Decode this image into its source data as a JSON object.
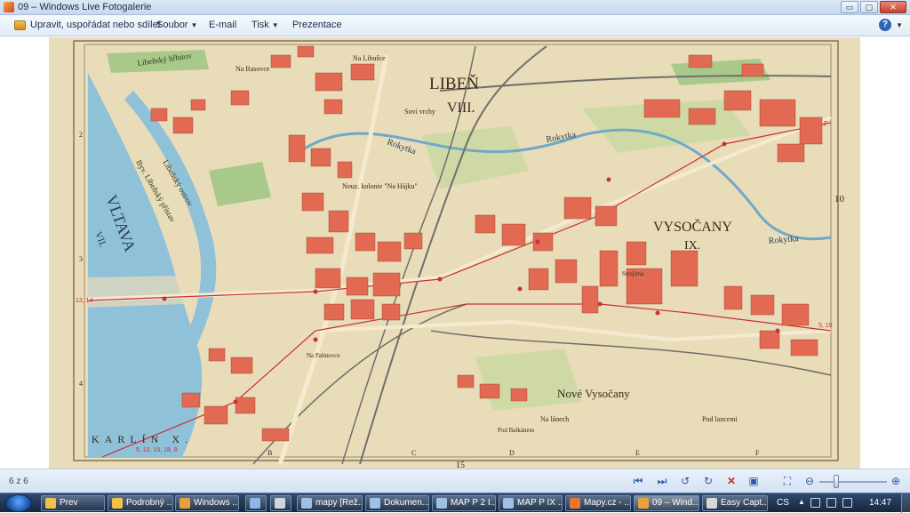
{
  "window": {
    "title": "09 – Windows Live Fotogalerie",
    "controls": {
      "minimize": "▭",
      "maximize": "▢",
      "close": "✕"
    }
  },
  "toolbar": {
    "organize": "Upravit, uspořádat nebo sdílet",
    "file": "Soubor",
    "email": "E-mail",
    "print": "Tisk",
    "slideshow": "Prezentace",
    "help": "?"
  },
  "map": {
    "district_liben": "LIBEŇ",
    "district_liben_num": "VIII.",
    "district_vysocany": "VYSOČANY",
    "district_vysocany_num": "IX.",
    "district_karlin": "KARLÍN X.",
    "river_vltava": "VLTAVA",
    "river_vltava_num": "VII.",
    "stream": "Rokytka",
    "stream_2": "Rokytka",
    "stream_3": "Rokytka",
    "cemetery": "Libeňský hřbitov",
    "port": "Byv. Libeňský přístav",
    "island": "Libeňský ostrov",
    "colony": "Nouz. kolonie \"Na Hájku\"",
    "nove_vysocany": "Nové Vysočany",
    "sovi_vrchy": "Soví vrchy",
    "na_rasovce": "Na Rasovce",
    "na_libusce": "Na Libušce",
    "pod_lancemi": "Pod lancemi",
    "na_lanech": "Na lánech",
    "pod_balkanem": "Pod Balkánem",
    "palmovka": "Na Palmovce",
    "stredoz": "Strojírna",
    "gridnum_10": "10",
    "sheet_num": "15",
    "col_b": "B",
    "col_c": "C",
    "col_d": "D",
    "col_e": "E",
    "col_f": "F",
    "row_2": "2",
    "row_3": "3",
    "row_4": "4",
    "edge_left": "13, 14",
    "edge_right": "5, 10",
    "edge_bottom": "5, 10, 15, 18, 8",
    "edge_f": "F"
  },
  "status": {
    "counter": "6 z 6"
  },
  "taskbar": {
    "items": [
      "Prev",
      "Podrobný ...",
      "Windows ...",
      "",
      "",
      "mapy [Rež...",
      "Dokumen...",
      "MAP P 2 I...",
      "MAP P IX ...",
      "Mapy.cz - ...",
      "09 – Wind...",
      "Easy Capt..."
    ],
    "lang": "CS",
    "clock": "14:47"
  },
  "colors": {
    "map_paper": "#e9dcb8",
    "building": "#e36a52",
    "water": "#8fc1d9",
    "green": "#a9c98b",
    "rail": "#6e6e6e",
    "tram": "#c9303a"
  }
}
